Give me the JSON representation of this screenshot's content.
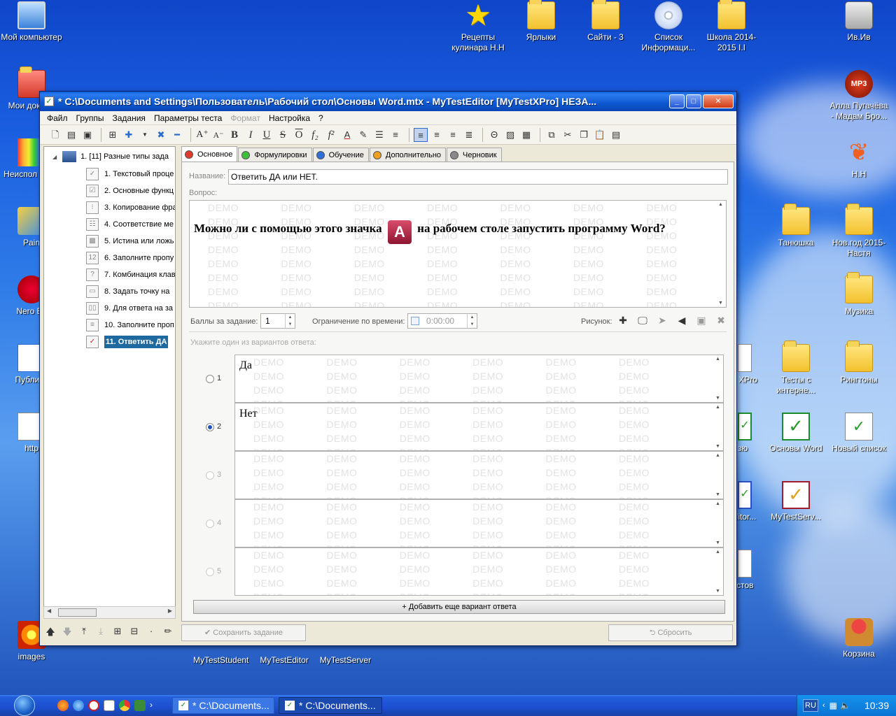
{
  "desktop": {
    "icons": [
      {
        "label": "Мой компьютер",
        "icon": "my-computer-icon"
      },
      {
        "label": "Мои докуме",
        "icon": "my-documents-icon"
      },
      {
        "label": "Неиспол ярлы",
        "icon": "unused-shortcuts-icon"
      },
      {
        "label": "Pain",
        "icon": "paint-icon"
      },
      {
        "label": "Nero Ex",
        "icon": "nero-icon"
      },
      {
        "label": "Публика",
        "icon": "publisher-icon"
      },
      {
        "label": "http",
        "icon": "document-icon"
      },
      {
        "label": "images",
        "icon": "images-icon"
      },
      {
        "label": "Рецепты кулинара Н.Н",
        "icon": "star-icon"
      },
      {
        "label": "Ярлыки",
        "icon": "folder-icon"
      },
      {
        "label": "Сайти - 3",
        "icon": "folder-icon"
      },
      {
        "label": "Список Информаци...",
        "icon": "cd-icon"
      },
      {
        "label": "Школа 2014-2015 І.І",
        "icon": "folder-icon"
      },
      {
        "label": "Ив.Ив",
        "icon": "camera-icon"
      },
      {
        "label": "Алла Пугачёва - Мадам Бро...",
        "icon": "mp3-icon"
      },
      {
        "label": "Н.Н",
        "icon": "butterfly-icon"
      },
      {
        "label": "Танюшка",
        "icon": "folder-icon"
      },
      {
        "label": "Нов.год 2015-Настя",
        "icon": "folder-icon"
      },
      {
        "label": "Музика",
        "icon": "folder-icon"
      },
      {
        "label": "ки XPro",
        "icon": "document-icon"
      },
      {
        "label": "Тесты с интерне...",
        "icon": "folder-icon"
      },
      {
        "label": "Рингтоны",
        "icon": "folder-icon"
      },
      {
        "label": "зю",
        "icon": "check-icon"
      },
      {
        "label": "Основы Word",
        "icon": "check-icon"
      },
      {
        "label": "Новый список",
        "icon": "check-document-icon"
      },
      {
        "label": "ditor...",
        "icon": "check-icon"
      },
      {
        "label": "MyTestServ...",
        "icon": "check-red-icon"
      },
      {
        "label": "естов",
        "icon": "document-icon"
      },
      {
        "label": "Корзина",
        "icon": "recycle-bin-icon"
      }
    ],
    "shortcuts": [
      "MyTestStudent",
      "MyTestEditor",
      "MyTestServer"
    ]
  },
  "window": {
    "title": "* C:\\Documents and Settings\\Пользователь\\Рабочий стол\\Основы Word.mtx - MyTestEditor [MyTestXPro] НЕЗА...",
    "menu": [
      "Файл",
      "Группы",
      "Задания",
      "Параметры теста",
      "Формат",
      "Настройка",
      "?"
    ],
    "menu_disabled": "Формат"
  },
  "tree": {
    "root": "1. [11] Разные типы зада",
    "items": [
      "1. Текстовый проце",
      "2. Основные функц",
      "3. Копирование фра",
      "4. Соответствие ме",
      "5. Истина или ложь",
      "6. Заполните пропу",
      "7. Комбинация клав",
      "8. Задать точку на",
      "9. Для ответа на за",
      "10. Заполните проп",
      "11. Ответить ДА"
    ],
    "selected_index": 10
  },
  "tabs": [
    {
      "label": "Основное",
      "color": "#e23b2e"
    },
    {
      "label": "Формулировки",
      "color": "#3fbf3a"
    },
    {
      "label": "Обучение",
      "color": "#2f6fd8"
    },
    {
      "label": "Дополнительно",
      "color": "#f0a020"
    },
    {
      "label": "Черновик",
      "color": "#8a8a8a"
    }
  ],
  "form": {
    "name_label": "Название:",
    "name_value": "Ответить ДА или НЕТ.",
    "question_label": "Вопрос:",
    "question_part1": "Можно ли с помощью этого значка",
    "question_part2": "на рабочем столе запустить программу Word?",
    "access_icon_letter": "A",
    "score_label": "Баллы за задание:",
    "score_value": "1",
    "time_label": "Ограничение по времени:",
    "time_value": "0:00:00",
    "picture_label": "Рисунок:",
    "answers_hint": "Укажите один из вариантов ответа:",
    "watermark": "DEMO",
    "answers": [
      {
        "num": "1",
        "text": "Да",
        "checked": false,
        "enabled": true
      },
      {
        "num": "2",
        "text": "Нет",
        "checked": true,
        "enabled": true
      },
      {
        "num": "3",
        "text": "",
        "checked": false,
        "enabled": false
      },
      {
        "num": "4",
        "text": "",
        "checked": false,
        "enabled": false
      },
      {
        "num": "5",
        "text": "",
        "checked": false,
        "enabled": false
      }
    ],
    "add_answer_label": "+ Добавить еще вариант ответа",
    "save_label": "Сохранить задание",
    "reset_label": "Сбросить"
  },
  "taskbar": {
    "tasks": [
      "* C:\\Documents...",
      "* C:\\Documents..."
    ],
    "lang": "RU",
    "time": "10:39"
  }
}
